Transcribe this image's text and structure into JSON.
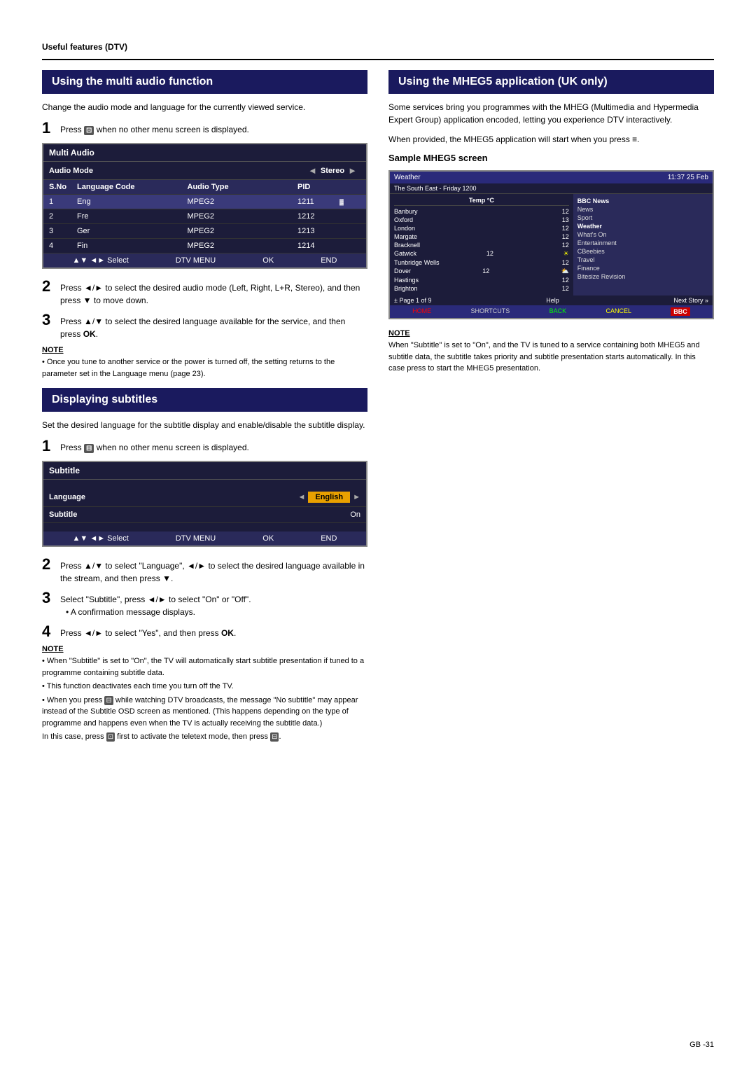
{
  "page": {
    "header": "Useful features (DTV)",
    "footer": "GB -31"
  },
  "leftCol": {
    "section1": {
      "title": "Using the multi audio function",
      "intro": "Change the audio mode and language for the currently viewed service.",
      "step1": {
        "num": "1",
        "text": "Press 🔵 when no other menu screen is displayed."
      },
      "osd": {
        "title": "Multi Audio",
        "audioModeLabel": "Audio Mode",
        "audioModeArrowLeft": "◄",
        "audioModeValue": "Stereo",
        "audioModeArrowRight": "►",
        "headers": [
          "S.No",
          "Language Code",
          "Audio Type",
          "PID"
        ],
        "rows": [
          {
            "sno": "1",
            "lang": "Eng",
            "type": "MPEG2",
            "pid": "1211",
            "highlight": true
          },
          {
            "sno": "2",
            "lang": "Fre",
            "type": "MPEG2",
            "pid": "1212",
            "highlight": false
          },
          {
            "sno": "3",
            "lang": "Ger",
            "type": "MPEG2",
            "pid": "1213",
            "highlight": false
          },
          {
            "sno": "4",
            "lang": "Fin",
            "type": "MPEG2",
            "pid": "1214",
            "highlight": false
          }
        ],
        "footer": [
          "▲▼  ◄►  Select",
          "DTV MENU",
          "OK",
          "END"
        ]
      },
      "step2": {
        "num": "2",
        "text": "Press ◄/► to select the desired audio mode (Left, Right, L+R, Stereo), and then press ▼ to move down."
      },
      "step3": {
        "num": "3",
        "text": "Press ▲/▼ to select the desired language available for the service, and then press OK."
      },
      "note": {
        "label": "NOTE",
        "points": [
          "Once you tune to another service or the power is turned off, the setting returns to the parameter set in the Language menu (page 23)."
        ]
      }
    },
    "section2": {
      "title": "Displaying subtitles",
      "intro": "Set the desired language for the subtitle display and enable/disable the subtitle display.",
      "step1": {
        "num": "1",
        "text": "Press  when no other menu screen is displayed."
      },
      "osd": {
        "title": "Subtitle",
        "rows": [
          {
            "label": "Language",
            "value": "English",
            "isHighlight": true
          },
          {
            "label": "Subtitle",
            "value": "On",
            "isHighlight": false
          }
        ],
        "footer": [
          "▲▼  ◄►  Select",
          "DTV MENU",
          "OK",
          "END"
        ]
      },
      "step2": {
        "num": "2",
        "text": "Press ▲/▼ to select \"Language\", ◄/► to select the desired language available in the stream, and then press ▼."
      },
      "step3": {
        "num": "3",
        "text": "Select \"Subtitle\", press ◄/► to select \"On\" or \"Off\".",
        "sub": "• A confirmation message displays."
      },
      "step4": {
        "num": "4",
        "text": "Press ◄/► to select \"Yes\", and then press OK."
      },
      "note": {
        "label": "NOTE",
        "points": [
          "When \"Subtitle\" is set to \"On\", the TV will automatically start subtitle presentation if tuned to a programme containing subtitle data.",
          "This function deactivates each time you turn off the TV.",
          "When you press  while watching DTV broadcasts, the message \"No subtitle\" may appear instead of the Subtitle OSD screen as mentioned. (This happens depending on the type of programme and happens even when the TV is actually receiving the subtitle data.)",
          "In this case, press  first to activate the teletext mode, then press ."
        ]
      }
    }
  },
  "rightCol": {
    "section1": {
      "title": "Using the MHEG5 application (UK only)",
      "intro1": "Some services bring you programmes with the MHEG (Multimedia and Hypermedia Expert Group) application encoded, letting you experience DTV interactively.",
      "intro2": "When provided, the MHEG5 application will start when you press ≡.",
      "sampleTitle": "Sample MHEG5 screen",
      "screen": {
        "headerLeft": "Weather",
        "headerRight": "11:37 25 Feb",
        "subHeader": "The South East - Friday 1200",
        "columnHeaders": [
          "",
          "Temp °C",
          ""
        ],
        "rows": [
          {
            "city": "Banbury",
            "temp": "12"
          },
          {
            "city": "Oxford",
            "temp": "13"
          },
          {
            "city": "London",
            "temp": "12"
          },
          {
            "city": "Margate",
            "temp": "12"
          },
          {
            "city": "Bracknell",
            "temp": "12"
          },
          {
            "city": "Gatwick",
            "temp": "12"
          },
          {
            "city": "Tunbridge Wells",
            "temp": "12"
          },
          {
            "city": "Dover",
            "temp": "12"
          },
          {
            "city": "Hastings",
            "temp": "12"
          },
          {
            "city": "Brighton",
            "temp": "12"
          }
        ],
        "menuItems": [
          "BBC News",
          "News",
          "Sport",
          "Weather",
          "What's On",
          "Entertainment",
          "CBeebies",
          "Travel",
          "Finance",
          "Bitesize Revision"
        ],
        "pageInfo": "± Page 1 of 9",
        "helpText": "Help",
        "nextStory": "Next Story »",
        "footerItems": [
          "HOME",
          "SHORTCUTS",
          "BACK",
          "CANCEL",
          "BBC"
        ]
      },
      "note": {
        "label": "NOTE",
        "text": "When \"Subtitle\" is set to \"On\", and the TV is tuned to a service containing both MHEG5 and subtitle data, the subtitle takes priority and subtitle presentation starts automatically. In this case press  to start the MHEG5 presentation."
      }
    }
  }
}
